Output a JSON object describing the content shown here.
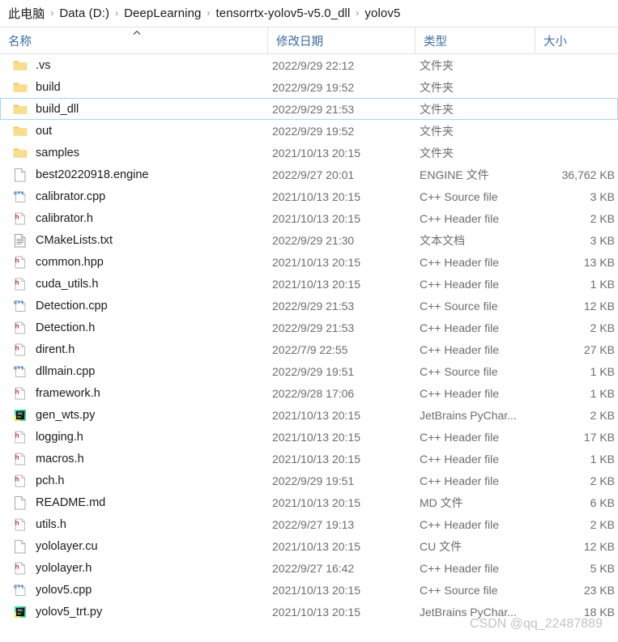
{
  "breadcrumb": {
    "separator": "›",
    "items": [
      {
        "label": "此电脑"
      },
      {
        "label": "Data (D:)"
      },
      {
        "label": "DeepLearning"
      },
      {
        "label": "tensorrtx-yolov5-v5.0_dll"
      },
      {
        "label": "yolov5"
      }
    ]
  },
  "columns": {
    "name": "名称",
    "date": "修改日期",
    "type": "类型",
    "size": "大小",
    "sort_indicator": "︿",
    "sort_direction": "ascending",
    "sort_column": "名称"
  },
  "colors": {
    "header_text": "#3f6ca3",
    "focus_border": "#a6d4f5",
    "folder": "#f5d376",
    "cpp_icon": "#1f6fb5",
    "header_icon": "#c0392b",
    "pycharm_green": "#21d789",
    "pycharm_yellow": "#f9ed32",
    "watermark": "#b9b9b9"
  },
  "watermark": "CSDN @qq_22487889",
  "files": [
    {
      "name": ".vs",
      "date": "2022/9/29 22:12",
      "type": "文件夹",
      "size": "",
      "icon": "folder-icon",
      "focused": false
    },
    {
      "name": "build",
      "date": "2022/9/29 19:52",
      "type": "文件夹",
      "size": "",
      "icon": "folder-icon",
      "focused": false
    },
    {
      "name": "build_dll",
      "date": "2022/9/29 21:53",
      "type": "文件夹",
      "size": "",
      "icon": "folder-icon",
      "focused": true
    },
    {
      "name": "out",
      "date": "2022/9/29 19:52",
      "type": "文件夹",
      "size": "",
      "icon": "folder-icon",
      "focused": false
    },
    {
      "name": "samples",
      "date": "2021/10/13 20:15",
      "type": "文件夹",
      "size": "",
      "icon": "folder-icon",
      "focused": false
    },
    {
      "name": "best20220918.engine",
      "date": "2022/9/27 20:01",
      "type": "ENGINE 文件",
      "size": "36,762 KB",
      "icon": "blank-file-icon",
      "focused": false
    },
    {
      "name": "calibrator.cpp",
      "date": "2021/10/13 20:15",
      "type": "C++ Source file",
      "size": "3 KB",
      "icon": "cpp-file-icon",
      "focused": false
    },
    {
      "name": "calibrator.h",
      "date": "2021/10/13 20:15",
      "type": "C++ Header file",
      "size": "2 KB",
      "icon": "header-file-icon",
      "focused": false
    },
    {
      "name": "CMakeLists.txt",
      "date": "2022/9/29 21:30",
      "type": "文本文档",
      "size": "3 KB",
      "icon": "text-file-icon",
      "focused": false
    },
    {
      "name": "common.hpp",
      "date": "2021/10/13 20:15",
      "type": "C++ Header file",
      "size": "13 KB",
      "icon": "header-file-icon",
      "focused": false
    },
    {
      "name": "cuda_utils.h",
      "date": "2021/10/13 20:15",
      "type": "C++ Header file",
      "size": "1 KB",
      "icon": "header-file-icon",
      "focused": false
    },
    {
      "name": "Detection.cpp",
      "date": "2022/9/29 21:53",
      "type": "C++ Source file",
      "size": "12 KB",
      "icon": "cpp-file-icon",
      "focused": false
    },
    {
      "name": "Detection.h",
      "date": "2022/9/29 21:53",
      "type": "C++ Header file",
      "size": "2 KB",
      "icon": "header-file-icon",
      "focused": false
    },
    {
      "name": "dirent.h",
      "date": "2022/7/9 22:55",
      "type": "C++ Header file",
      "size": "27 KB",
      "icon": "header-file-icon",
      "focused": false
    },
    {
      "name": "dllmain.cpp",
      "date": "2022/9/29 19:51",
      "type": "C++ Source file",
      "size": "1 KB",
      "icon": "cpp-file-icon",
      "focused": false
    },
    {
      "name": "framework.h",
      "date": "2022/9/28 17:06",
      "type": "C++ Header file",
      "size": "1 KB",
      "icon": "header-file-icon",
      "focused": false
    },
    {
      "name": "gen_wts.py",
      "date": "2021/10/13 20:15",
      "type": "JetBrains PyChar...",
      "size": "2 KB",
      "icon": "pycharm-file-icon",
      "focused": false
    },
    {
      "name": "logging.h",
      "date": "2021/10/13 20:15",
      "type": "C++ Header file",
      "size": "17 KB",
      "icon": "header-file-icon",
      "focused": false
    },
    {
      "name": "macros.h",
      "date": "2021/10/13 20:15",
      "type": "C++ Header file",
      "size": "1 KB",
      "icon": "header-file-icon",
      "focused": false
    },
    {
      "name": "pch.h",
      "date": "2022/9/29 19:51",
      "type": "C++ Header file",
      "size": "2 KB",
      "icon": "header-file-icon",
      "focused": false
    },
    {
      "name": "README.md",
      "date": "2021/10/13 20:15",
      "type": "MD 文件",
      "size": "6 KB",
      "icon": "blank-file-icon",
      "focused": false
    },
    {
      "name": "utils.h",
      "date": "2022/9/27 19:13",
      "type": "C++ Header file",
      "size": "2 KB",
      "icon": "header-file-icon",
      "focused": false
    },
    {
      "name": "yololayer.cu",
      "date": "2021/10/13 20:15",
      "type": "CU 文件",
      "size": "12 KB",
      "icon": "blank-file-icon",
      "focused": false
    },
    {
      "name": "yololayer.h",
      "date": "2022/9/27 16:42",
      "type": "C++ Header file",
      "size": "5 KB",
      "icon": "header-file-icon",
      "focused": false
    },
    {
      "name": "yolov5.cpp",
      "date": "2021/10/13 20:15",
      "type": "C++ Source file",
      "size": "23 KB",
      "icon": "cpp-file-icon",
      "focused": false
    },
    {
      "name": "yolov5_trt.py",
      "date": "2021/10/13 20:15",
      "type": "JetBrains PyChar...",
      "size": "18 KB",
      "icon": "pycharm-file-icon",
      "focused": false
    }
  ]
}
